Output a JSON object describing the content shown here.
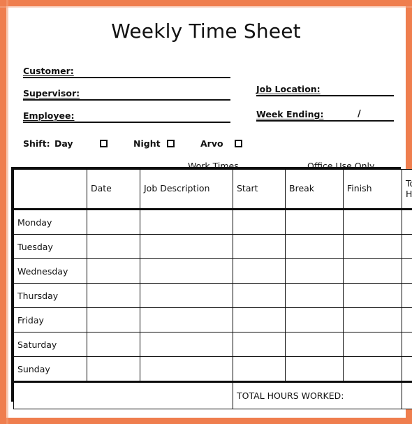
{
  "document": {
    "title": "Weekly Time Sheet",
    "accent_color": "#ef7e4e",
    "ink_color": "#111111"
  },
  "form_fields": {
    "left": [
      {
        "label": "Customer:",
        "value": ""
      },
      {
        "label": "Supervisor:",
        "value": ""
      },
      {
        "label": "Employee:",
        "value": ""
      }
    ],
    "right": [
      {
        "label": "Job Location:",
        "value": ""
      },
      {
        "label": "Week Ending:",
        "value": "",
        "separator": "/"
      }
    ]
  },
  "shift": {
    "label": "Shift:",
    "options": [
      {
        "label": "Day",
        "checked": false
      },
      {
        "label": "Night",
        "checked": false
      },
      {
        "label": "Arvo",
        "checked": false
      }
    ]
  },
  "group_captions": {
    "work_times": "Work Times",
    "office_use_only": "Office Use Only"
  },
  "table": {
    "columns": [
      "",
      "Date",
      "Job Description",
      "Start",
      "Break",
      "Finish",
      "Total Hours"
    ],
    "column_header_total_line1": "Total",
    "column_header_total_line2": "Hours",
    "rows": [
      {
        "day": "Monday",
        "date": "",
        "job_description": "",
        "start": "",
        "break": "",
        "finish": "",
        "total_hours": ""
      },
      {
        "day": "Tuesday",
        "date": "",
        "job_description": "",
        "start": "",
        "break": "",
        "finish": "",
        "total_hours": ""
      },
      {
        "day": "Wednesday",
        "date": "",
        "job_description": "",
        "start": "",
        "break": "",
        "finish": "",
        "total_hours": ""
      },
      {
        "day": "Thursday",
        "date": "",
        "job_description": "",
        "start": "",
        "break": "",
        "finish": "",
        "total_hours": ""
      },
      {
        "day": "Friday",
        "date": "",
        "job_description": "",
        "start": "",
        "break": "",
        "finish": "",
        "total_hours": ""
      },
      {
        "day": "Saturday",
        "date": "",
        "job_description": "",
        "start": "",
        "break": "",
        "finish": "",
        "total_hours": ""
      },
      {
        "day": "Sunday",
        "date": "",
        "job_description": "",
        "start": "",
        "break": "",
        "finish": "",
        "total_hours": ""
      }
    ],
    "footer": {
      "blank_left": "",
      "total_label": "TOTAL HOURS WORKED:",
      "total_value": ""
    }
  }
}
